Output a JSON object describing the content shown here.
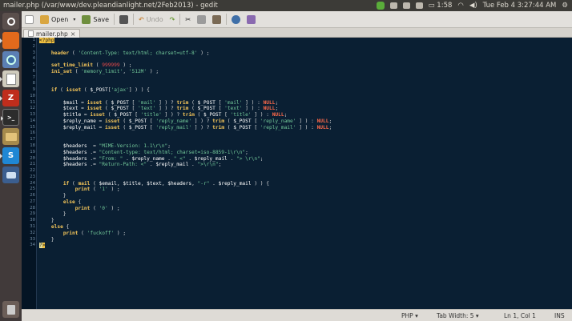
{
  "window": {
    "title": "mailer.php (/var/www/dev.pleandianlight.net/2Feb2013) - gedit"
  },
  "panel": {
    "datetime": "Tue Feb 4  3:27:44 AM",
    "battery_time": "1:58"
  },
  "toolbar": {
    "open_label": "Open",
    "save_label": "Save",
    "undo_label": "Undo"
  },
  "tab": {
    "label": "mailer.php",
    "close": "×"
  },
  "status": {
    "language": "PHP ▾",
    "tab_width": "Tab Width: 5 ▾",
    "position": "Ln 1, Col 1",
    "mode": "INS"
  },
  "launcher": {
    "filezilla_letter": "Z",
    "s_letter": "S"
  },
  "code_lines": [
    [
      [
        "tag",
        "<?php"
      ]
    ],
    [],
    [
      [
        "t",
        "\t"
      ],
      [
        "kw",
        "header"
      ],
      [
        "t",
        " ( "
      ],
      [
        "str",
        "'Content-Type: text/html; charset=utf-8'"
      ],
      [
        "t",
        " ) ;"
      ]
    ],
    [],
    [
      [
        "t",
        "\t"
      ],
      [
        "kw",
        "set_time_limit"
      ],
      [
        "t",
        " ( "
      ],
      [
        "num",
        "999999"
      ],
      [
        "t",
        " ) ;"
      ]
    ],
    [
      [
        "t",
        "\t"
      ],
      [
        "kw",
        "ini_set"
      ],
      [
        "t",
        " ( "
      ],
      [
        "str",
        "'memory_limit'"
      ],
      [
        "t",
        ", "
      ],
      [
        "str",
        "'512M'"
      ],
      [
        "t",
        " ) ;"
      ]
    ],
    [],
    [],
    [
      [
        "t",
        "\t"
      ],
      [
        "kw",
        "if"
      ],
      [
        "t",
        " ( "
      ],
      [
        "kw",
        "isset"
      ],
      [
        "t",
        " ( "
      ],
      [
        "var",
        "$_POST"
      ],
      [
        "t",
        "["
      ],
      [
        "str",
        "'ajax'"
      ],
      [
        "t",
        "] ) ) {"
      ]
    ],
    [],
    [
      [
        "t",
        "\t\t"
      ],
      [
        "var",
        "$mail"
      ],
      [
        "t",
        " = "
      ],
      [
        "kw",
        "isset"
      ],
      [
        "t",
        " ( "
      ],
      [
        "var",
        "$_POST"
      ],
      [
        "t",
        " [ "
      ],
      [
        "str",
        "'mail'"
      ],
      [
        "t",
        " ] ) ? "
      ],
      [
        "kw",
        "trim"
      ],
      [
        "t",
        " ( "
      ],
      [
        "var",
        "$_POST"
      ],
      [
        "t",
        " [ "
      ],
      [
        "str",
        "'mail'"
      ],
      [
        "t",
        " ] ) : "
      ],
      [
        "cst",
        "NULL"
      ],
      [
        "t",
        ";"
      ]
    ],
    [
      [
        "t",
        "\t\t"
      ],
      [
        "var",
        "$text"
      ],
      [
        "t",
        " = "
      ],
      [
        "kw",
        "isset"
      ],
      [
        "t",
        " ( "
      ],
      [
        "var",
        "$_POST"
      ],
      [
        "t",
        " [ "
      ],
      [
        "str",
        "'text'"
      ],
      [
        "t",
        " ] ) ? "
      ],
      [
        "kw",
        "trim"
      ],
      [
        "t",
        " ( "
      ],
      [
        "var",
        "$_POST"
      ],
      [
        "t",
        " [ "
      ],
      [
        "str",
        "'text'"
      ],
      [
        "t",
        " ] ) : "
      ],
      [
        "cst",
        "NULL"
      ],
      [
        "t",
        ";"
      ]
    ],
    [
      [
        "t",
        "\t\t"
      ],
      [
        "var",
        "$title"
      ],
      [
        "t",
        " = "
      ],
      [
        "kw",
        "isset"
      ],
      [
        "t",
        " ( "
      ],
      [
        "var",
        "$_POST"
      ],
      [
        "t",
        " [ "
      ],
      [
        "str",
        "'title'"
      ],
      [
        "t",
        " ] ) ? "
      ],
      [
        "kw",
        "trim"
      ],
      [
        "t",
        " ( "
      ],
      [
        "var",
        "$_POST"
      ],
      [
        "t",
        " [ "
      ],
      [
        "str",
        "'title'"
      ],
      [
        "t",
        " ] ) : "
      ],
      [
        "cst",
        "NULL"
      ],
      [
        "t",
        ";"
      ]
    ],
    [
      [
        "t",
        "\t\t"
      ],
      [
        "var",
        "$reply_name"
      ],
      [
        "t",
        " = "
      ],
      [
        "kw",
        "isset"
      ],
      [
        "t",
        " ( "
      ],
      [
        "var",
        "$_POST"
      ],
      [
        "t",
        " [ "
      ],
      [
        "str",
        "'reply_name'"
      ],
      [
        "t",
        " ] ) ? "
      ],
      [
        "kw",
        "trim"
      ],
      [
        "t",
        " ( "
      ],
      [
        "var",
        "$_POST"
      ],
      [
        "t",
        " [ "
      ],
      [
        "str",
        "'reply_name'"
      ],
      [
        "t",
        " ] ) : "
      ],
      [
        "cst",
        "NULL"
      ],
      [
        "t",
        ";"
      ]
    ],
    [
      [
        "t",
        "\t\t"
      ],
      [
        "var",
        "$reply_mail"
      ],
      [
        "t",
        " = "
      ],
      [
        "kw",
        "isset"
      ],
      [
        "t",
        " ( "
      ],
      [
        "var",
        "$_POST"
      ],
      [
        "t",
        " [ "
      ],
      [
        "str",
        "'reply_mail'"
      ],
      [
        "t",
        " ] ) ? "
      ],
      [
        "kw",
        "trim"
      ],
      [
        "t",
        " ( "
      ],
      [
        "var",
        "$_POST"
      ],
      [
        "t",
        " [ "
      ],
      [
        "str",
        "'reply_mail'"
      ],
      [
        "t",
        " ] ) : "
      ],
      [
        "cst",
        "NULL"
      ],
      [
        "t",
        ";"
      ]
    ],
    [],
    [],
    [
      [
        "t",
        "\t\t"
      ],
      [
        "var",
        "$headers"
      ],
      [
        "t",
        "  = "
      ],
      [
        "str",
        "\"MIME-Version: 1.1\\r\\n\""
      ],
      [
        "t",
        ";"
      ]
    ],
    [
      [
        "t",
        "\t\t"
      ],
      [
        "var",
        "$headers"
      ],
      [
        "t",
        " .= "
      ],
      [
        "str",
        "\"Content-type: text/html; charset=iso-8859-1\\r\\n\""
      ],
      [
        "t",
        ";"
      ]
    ],
    [
      [
        "t",
        "\t\t"
      ],
      [
        "var",
        "$headers"
      ],
      [
        "t",
        " .= "
      ],
      [
        "str",
        "\"From: \""
      ],
      [
        "t",
        " . "
      ],
      [
        "var",
        "$reply_name"
      ],
      [
        "t",
        " . "
      ],
      [
        "str",
        "\" <\""
      ],
      [
        "t",
        " . "
      ],
      [
        "var",
        "$reply_mail"
      ],
      [
        "t",
        " . "
      ],
      [
        "str",
        "\"> \\r\\n\""
      ],
      [
        "t",
        ";"
      ]
    ],
    [
      [
        "t",
        "\t\t"
      ],
      [
        "var",
        "$headers"
      ],
      [
        "t",
        " .= "
      ],
      [
        "str",
        "\"Return-Path: <\""
      ],
      [
        "t",
        " . "
      ],
      [
        "var",
        "$reply_mail"
      ],
      [
        "t",
        " . "
      ],
      [
        "str",
        "\">\\r\\n\""
      ],
      [
        "t",
        ";"
      ]
    ],
    [],
    [],
    [
      [
        "t",
        "\t\t"
      ],
      [
        "kw",
        "if"
      ],
      [
        "t",
        " ( "
      ],
      [
        "kw",
        "mail"
      ],
      [
        "t",
        " ( "
      ],
      [
        "var",
        "$email"
      ],
      [
        "t",
        ", "
      ],
      [
        "var",
        "$title"
      ],
      [
        "t",
        ", "
      ],
      [
        "var",
        "$text"
      ],
      [
        "t",
        ", "
      ],
      [
        "var",
        "$headers"
      ],
      [
        "t",
        ", "
      ],
      [
        "str",
        "\"-r\""
      ],
      [
        "t",
        " . "
      ],
      [
        "var",
        "$reply_mail"
      ],
      [
        "t",
        " ) ) {"
      ]
    ],
    [
      [
        "t",
        "\t\t\t"
      ],
      [
        "kw",
        "print"
      ],
      [
        "t",
        " ( "
      ],
      [
        "str",
        "'1'"
      ],
      [
        "t",
        " ) ;"
      ]
    ],
    [
      [
        "t",
        "\t\t}"
      ]
    ],
    [
      [
        "t",
        "\t\t"
      ],
      [
        "kw",
        "else"
      ],
      [
        "t",
        " {"
      ]
    ],
    [
      [
        "t",
        "\t\t\t"
      ],
      [
        "kw",
        "print"
      ],
      [
        "t",
        " ( "
      ],
      [
        "str",
        "'0'"
      ],
      [
        "t",
        " ) ;"
      ]
    ],
    [
      [
        "t",
        "\t\t}"
      ]
    ],
    [
      [
        "t",
        "\t}"
      ]
    ],
    [
      [
        "t",
        "\t"
      ],
      [
        "kw",
        "else"
      ],
      [
        "t",
        " {"
      ]
    ],
    [
      [
        "t",
        "\t\t"
      ],
      [
        "kw",
        "print"
      ],
      [
        "t",
        " ( "
      ],
      [
        "str",
        "'fuckoff'"
      ],
      [
        "t",
        " ) ;"
      ]
    ],
    [
      [
        "t",
        "\t}"
      ]
    ],
    [
      [
        "cur",
        "?"
      ],
      [
        "tag",
        ">"
      ]
    ]
  ],
  "colors": {
    "editor_bg": "#0a1f33",
    "keyword": "#f5c65a",
    "string": "#73c99a",
    "number": "#e84a4a",
    "constant": "#ff6a4a"
  }
}
